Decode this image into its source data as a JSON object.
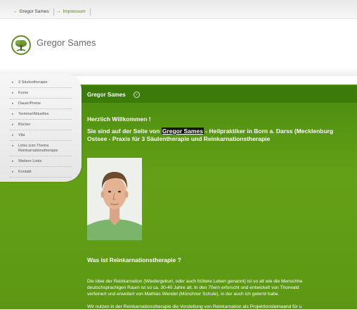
{
  "topnav": [
    {
      "label": "Gregor Sames"
    },
    {
      "label": "Impressum"
    }
  ],
  "brand": {
    "name": "Gregor Sames"
  },
  "sidebar": {
    "items": [
      {
        "label": "3 Säulentherapie"
      },
      {
        "label": "Kurse"
      },
      {
        "label": "Dauer/Preise"
      },
      {
        "label": "Termine/Aktuelles"
      },
      {
        "label": "Bücher"
      },
      {
        "label": "Vita"
      },
      {
        "label": "Links zum Thema Reinkarnationstherapie"
      },
      {
        "label": "Weitere Links"
      },
      {
        "label": "Kontakt"
      }
    ]
  },
  "breadcrumb": {
    "label": "Gregor Sames"
  },
  "main": {
    "welcome": "Herzlich Willkommen !",
    "intro_pre": "Sie sind auf der Seite von ",
    "intro_link": "Gregor Sames",
    "intro_post": " - Heilpraktiker in Born a. Darss (Mecklenburg",
    "intro_line2": "Ostsee - Praxis für 3 Säulentherapie und Reinkarnationstherapie",
    "question": "Was ist Reinkarnationstherapie ?",
    "para_lines": [
      "Die Idee der Reinkarnation (Wiedergeburt, oder auch frühere Leben genannt) ist so alt wie die Menschhe",
      "deutschsprachigen Raum ist so ca. 30-40 Jahre alt. In den 70ern erforscht und entwickelt von Thorwald",
      "verfeinert und erweitert von Mathias Wendel (Münchner Schule), in der auch ich gelernt habe."
    ],
    "para2": "Wir nutzen in der Reinkarnationstherapie die Vorstellung von Reinkarnation als Projektionsleinwand für u"
  },
  "colors": {
    "accent": "#4f8a10",
    "content_bg": "#5d9814",
    "crumb_bg": "#3a7b0a"
  }
}
